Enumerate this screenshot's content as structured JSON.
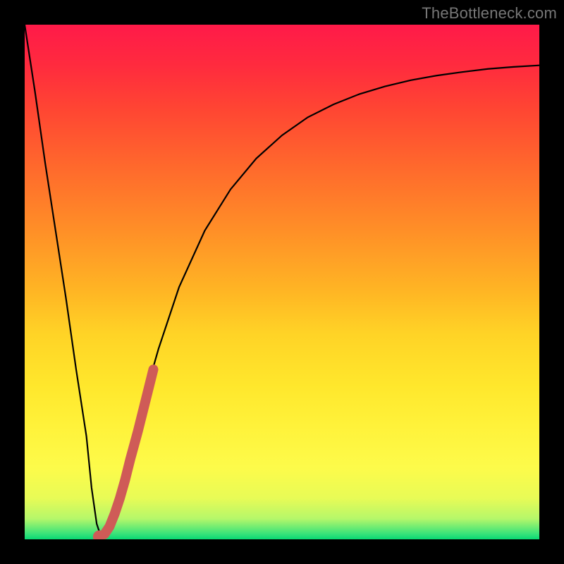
{
  "watermark": "TheBottleneck.com",
  "chart_data": {
    "type": "line",
    "title": "",
    "xlabel": "",
    "ylabel": "",
    "xlim": [
      0,
      100
    ],
    "ylim": [
      0,
      100
    ],
    "grid": false,
    "legend": false,
    "background_gradient": {
      "direction": "vertical",
      "stops": [
        {
          "pos": 0,
          "color": "#ff1a49"
        },
        {
          "pos": 50,
          "color": "#ffb624"
        },
        {
          "pos": 80,
          "color": "#fff23a"
        },
        {
          "pos": 100,
          "color": "#08d873"
        }
      ]
    },
    "series": [
      {
        "name": "bottleneck-curve",
        "type": "line",
        "color": "#000000",
        "width": 2,
        "x": [
          0,
          2,
          4,
          6,
          8,
          10,
          12,
          13,
          14,
          15,
          16,
          18,
          20,
          22,
          24,
          26,
          30,
          35,
          40,
          45,
          50,
          55,
          60,
          65,
          70,
          75,
          80,
          85,
          90,
          95,
          100
        ],
        "values": [
          100,
          87,
          73,
          60,
          47,
          33,
          20,
          10,
          3,
          0,
          1,
          7,
          14,
          22,
          30,
          37,
          49,
          60,
          68,
          74,
          78.5,
          82,
          84.5,
          86.5,
          88,
          89.2,
          90.1,
          90.8,
          91.4,
          91.8,
          92.1
        ]
      },
      {
        "name": "highlight-band",
        "type": "line",
        "color": "#cf5b57",
        "width": 14,
        "linecap": "round",
        "x": [
          15.5,
          16.5,
          17.5,
          18.5,
          19.5,
          20.5,
          22.0,
          23.5,
          25.0
        ],
        "values": [
          1.0,
          2.5,
          5.0,
          8.0,
          11.5,
          15.5,
          21.0,
          27.0,
          33.0
        ]
      },
      {
        "name": "highlight-cap",
        "type": "scatter",
        "color": "#cf5b57",
        "radius": 9,
        "x": [
          14.5
        ],
        "values": [
          0.5
        ]
      }
    ]
  }
}
